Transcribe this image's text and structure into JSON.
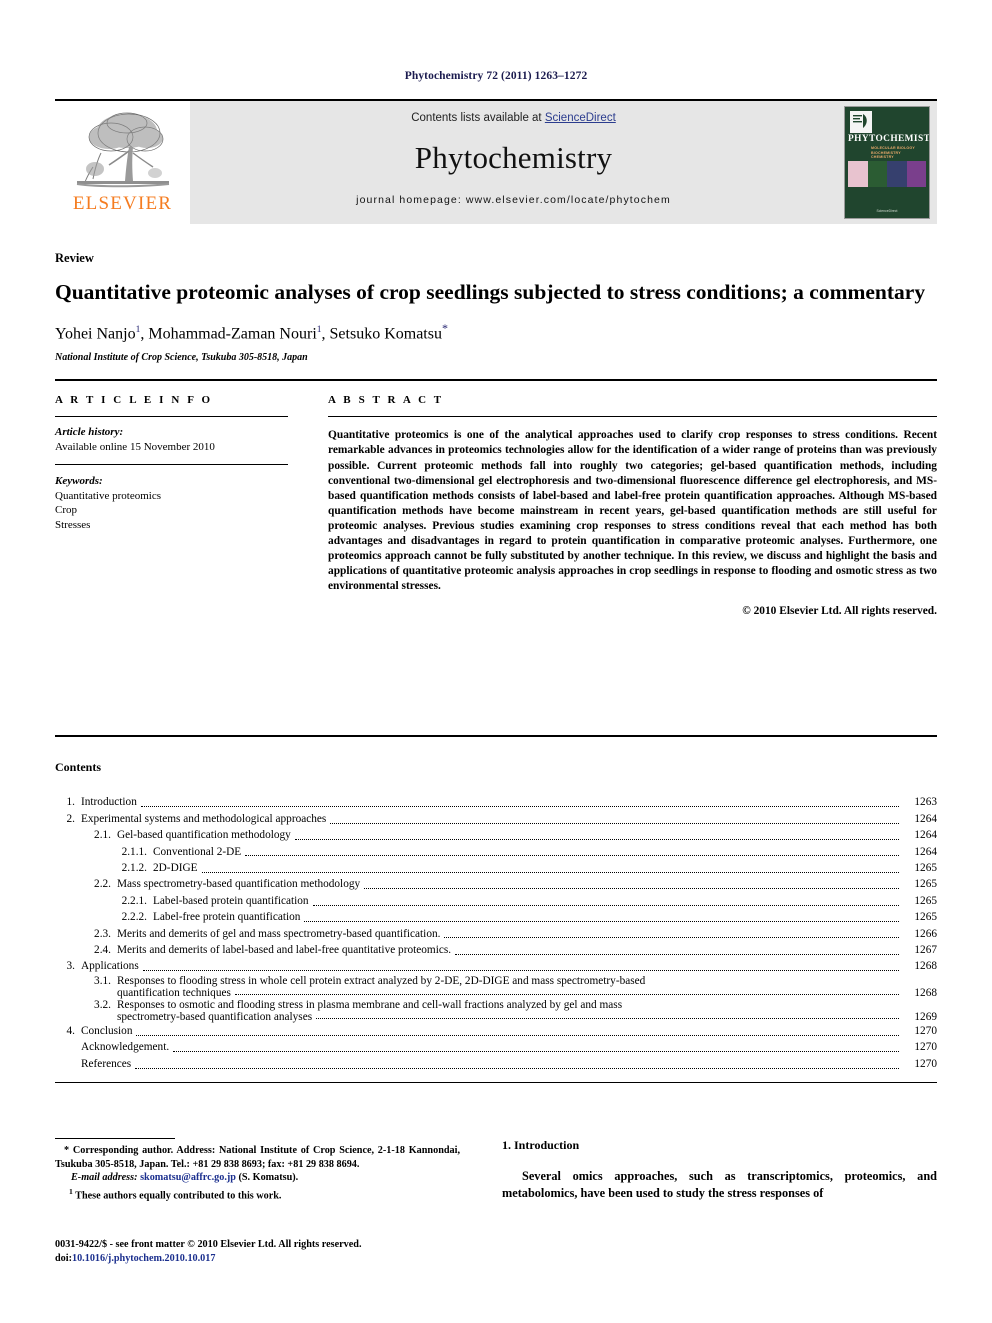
{
  "running_head": "Phytochemistry 72 (2011) 1263–1272",
  "banner": {
    "publisher_logo_text": "ELSEVIER",
    "contents_prefix": "Contents lists available at ",
    "contents_link": "ScienceDirect",
    "journal_name": "Phytochemistry",
    "homepage": "journal homepage: www.elsevier.com/locate/phytochem",
    "cover": {
      "title": "PHYTOCHEMISTRY",
      "sub1": "MOLECULAR BIOLOGY",
      "sub2": "BIOCHEMISTRY",
      "sub3": "CHEMISTRY",
      "footer": "ScienceDirect"
    },
    "link_color": "#2b3c8e",
    "logo_color": "#f57c20",
    "banner_bg": "#e6e6e6",
    "cover_bg": "#20452e"
  },
  "article": {
    "type": "Review",
    "title": "Quantitative proteomic analyses of crop seedlings subjected to stress conditions; a commentary",
    "authors": [
      {
        "name": "Yohei Nanjo",
        "marks": "1"
      },
      {
        "name": "Mohammad-Zaman Nouri",
        "marks": "1"
      },
      {
        "name": "Setsuko Komatsu",
        "marks": "*"
      }
    ],
    "affiliation": "National Institute of Crop Science, Tsukuba 305-8518, Japan"
  },
  "info": {
    "label": "A R T I C L E   I N F O",
    "history_label": "Article history:",
    "history_value": "Available online 15 November 2010",
    "keywords_label": "Keywords:",
    "keywords": [
      "Quantitative proteomics",
      "Crop",
      "Stresses"
    ]
  },
  "abstract": {
    "label": "A B S T R A C T",
    "text": "Quantitative proteomics is one of the analytical approaches used to clarify crop responses to stress conditions. Recent remarkable advances in proteomics technologies allow for the identification of a wider range of proteins than was previously possible. Current proteomic methods fall into roughly two categories; gel-based quantification methods, including conventional two-dimensional gel electrophoresis and two-dimensional fluorescence difference gel electrophoresis, and MS-based quantification methods consists of label-based and label-free protein quantification approaches. Although MS-based quantification methods have become mainstream in recent years, gel-based quantification methods are still useful for proteomic analyses. Previous studies examining crop responses to stress conditions reveal that each method has both advantages and disadvantages in regard to protein quantification in comparative proteomic analyses. Furthermore, one proteomics approach cannot be fully substituted by another technique. In this review, we discuss and highlight the basis and applications of quantitative proteomic analysis approaches in crop seedlings in response to flooding and osmotic stress as two environmental stresses.",
    "copyright": "© 2010 Elsevier Ltd. All rights reserved."
  },
  "contents": {
    "heading": "Contents",
    "entries": [
      {
        "level": 1,
        "num": "1.",
        "label": "Introduction",
        "page": "1263"
      },
      {
        "level": 1,
        "num": "2.",
        "label": "Experimental systems and methodological approaches",
        "page": "1264"
      },
      {
        "level": 2,
        "num": "2.1.",
        "label": "Gel-based quantification methodology",
        "page": "1264"
      },
      {
        "level": 3,
        "num": "2.1.1.",
        "label": "Conventional 2-DE",
        "page": "1264"
      },
      {
        "level": 3,
        "num": "2.1.2.",
        "label": "2D-DIGE",
        "page": "1265"
      },
      {
        "level": 2,
        "num": "2.2.",
        "label": "Mass spectrometry-based quantification methodology",
        "page": "1265"
      },
      {
        "level": 3,
        "num": "2.2.1.",
        "label": "Label-based protein quantification",
        "page": "1265"
      },
      {
        "level": 3,
        "num": "2.2.2.",
        "label": "Label-free protein quantification",
        "page": "1265"
      },
      {
        "level": 2,
        "num": "2.3.",
        "label": "Merits and demerits of gel and mass spectrometry-based quantification.",
        "page": "1266"
      },
      {
        "level": 2,
        "num": "2.4.",
        "label": "Merits and demerits of label-based and label-free quantitative proteomics.",
        "page": "1267"
      },
      {
        "level": 1,
        "num": "3.",
        "label": "Applications",
        "page": "1268"
      },
      {
        "level": 2,
        "num": "3.1.",
        "label": "Responses to flooding stress in whole cell protein extract analyzed by 2-DE, 2D-DIGE and mass spectrometry-based",
        "label2": "quantification techniques",
        "page": "1268",
        "wrap": true
      },
      {
        "level": 2,
        "num": "3.2.",
        "label": "Responses to osmotic and flooding stress in plasma membrane and cell-wall fractions analyzed by gel and mass",
        "label2": "spectrometry-based quantification analyses",
        "page": "1269",
        "wrap": true
      },
      {
        "level": 1,
        "num": "4.",
        "label": "Conclusion",
        "page": "1270"
      },
      {
        "level": 0,
        "num": "",
        "label": "Acknowledgement.",
        "page": "1270"
      },
      {
        "level": 0,
        "num": "",
        "label": "References",
        "page": "1270"
      }
    ]
  },
  "footnotes": {
    "corresponding": "* Corresponding author. Address: National Institute of Crop Science, 2-1-18 Kannondai, Tsukuba 305-8518, Japan. Tel.: +81 29 838 8693; fax: +81 29 838 8694.",
    "email_label": "E-mail address:",
    "email": "skomatsu@affrc.go.jp",
    "email_suffix": "(S. Komatsu).",
    "equal_contrib_mark": "1",
    "equal_contrib": "These authors equally contributed to this work."
  },
  "imprint": {
    "issn_line": "0031-9422/$ - see front matter © 2010 Elsevier Ltd. All rights reserved.",
    "doi_label": "doi:",
    "doi": "10.1016/j.phytochem.2010.10.017"
  },
  "introduction": {
    "heading": "1. Introduction",
    "paragraph": "Several omics approaches, such as transcriptomics, proteomics, and metabolomics, have been used to study the stress responses of"
  }
}
